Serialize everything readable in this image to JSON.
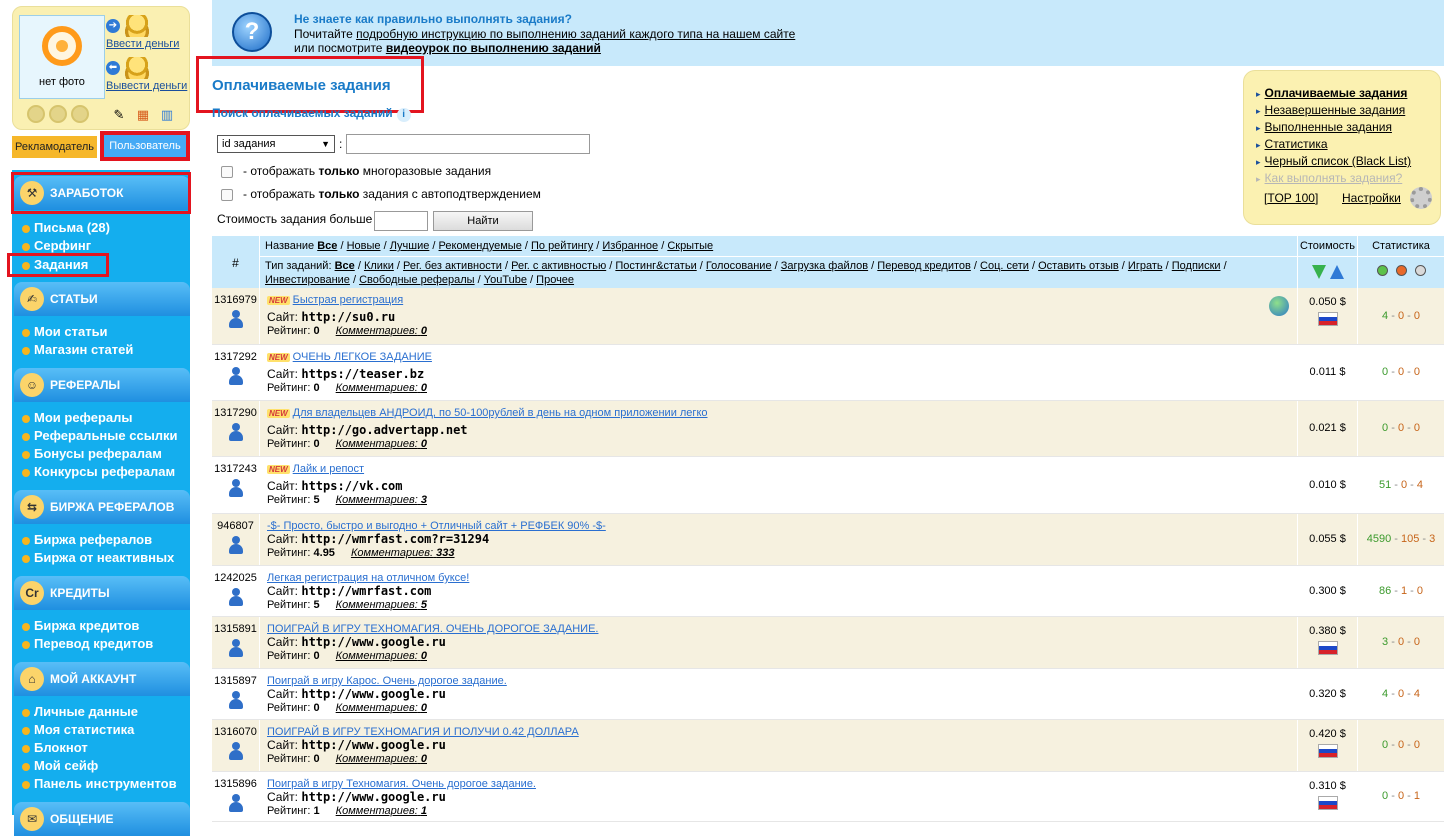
{
  "sidebar": {
    "avatar_caption": "нет фото",
    "deposit_label": "Ввести деньги",
    "withdraw_label": "Вывести деньги",
    "role_advertiser": "Рекламодатель",
    "role_user": "Пользователь",
    "sections": [
      {
        "title": "ЗАРАБОТОК",
        "items": [
          "Письма (28)",
          "Серфинг",
          "Задания"
        ]
      },
      {
        "title": "СТАТЬИ",
        "items": [
          "Мои статьи",
          "Магазин статей"
        ]
      },
      {
        "title": "РЕФЕРАЛЫ",
        "items": [
          "Мои рефералы",
          "Реферальные ссылки",
          "Бонусы рефералам",
          "Конкурсы рефералам"
        ]
      },
      {
        "title": "БИРЖА РЕФЕРАЛОВ",
        "items": [
          "Биржа рефералов",
          "Биржа от неактивных"
        ]
      },
      {
        "title": "КРЕДИТЫ",
        "items": [
          "Биржа кредитов",
          "Перевод кредитов"
        ]
      },
      {
        "title": "МОЙ АККАУНТ",
        "items": [
          "Личные данные",
          "Моя статистика",
          "Блокнот",
          "Мой сейф",
          "Панель инструментов"
        ]
      },
      {
        "title": "ОБЩЕНИЕ",
        "items": []
      }
    ]
  },
  "banner": {
    "question": "Не знаете как правильно выполнять задания?",
    "line2_prefix": "Почитайте ",
    "line2_link": "подробную инструкцию по выполнению заданий каждого типа на нашем сайте",
    "line3_prefix": "или посмотрите ",
    "line3_link": "видеоурок по выполнению заданий"
  },
  "page": {
    "title": "Оплачиваемые задания",
    "search_caption": "Поиск оплачиваемых заданий",
    "select_value": "id задания",
    "chk_multi_pre": "- отображать ",
    "chk_multi_bold": "только",
    "chk_multi_post": " многоразовые задания",
    "chk_auto_pre": "- отображать ",
    "chk_auto_bold": "только",
    "chk_auto_post": " задания с автоподтверждением",
    "cost_label": "Стоимость задания больше",
    "find_button": "Найти"
  },
  "rightbox": {
    "items": [
      "Оплачиваемые задания",
      "Незавершенные задания",
      "Выполненные задания",
      "Статистика",
      "Черный список (Black List)",
      "Как выполнять задания?"
    ],
    "top100": "TOP 100",
    "settings": "Настройки"
  },
  "table": {
    "col_num": "#",
    "col_cost": "Стоимость",
    "col_stat": "Статистика",
    "name_label": "Название",
    "name_filters": [
      "Все",
      "Новые",
      "Лучшие",
      "Рекомендуемые",
      "По рейтингу",
      "Избранное",
      "Скрытые"
    ],
    "type_label": "Тип заданий:",
    "type_filters_l1": [
      "Все",
      "Клики",
      "Рег. без активности",
      "Рег. с активностью",
      "Постинг&статьи",
      "Голосование",
      "Загрузка файлов",
      "Перевод кредитов",
      "Соц. сети",
      "Оставить отзыв",
      "Играть",
      "Подписки"
    ],
    "type_filters_l2": [
      "Инвестирование",
      "Свободные рефералы",
      "YouTube",
      "Прочее"
    ],
    "site_label": "Сайт:",
    "rating_label": "Рейтинг:",
    "comments_label": "Комментариев:",
    "new_badge": "NEW",
    "rows": [
      {
        "id": "1316979",
        "new": true,
        "title": "Быстрая регистрация",
        "site": "http://su0.ru",
        "rating": "0",
        "comments": "0",
        "cost": "0.050 $",
        "flag": true,
        "globe": true,
        "s1": "4",
        "s2": "0",
        "s3": "0"
      },
      {
        "id": "1317292",
        "new": true,
        "title": "ОЧЕНЬ ЛЕГКОЕ ЗАДАНИЕ",
        "site": "https://teaser.bz",
        "rating": "0",
        "comments": "0",
        "cost": "0.011 $",
        "flag": false,
        "s1": "0",
        "s2": "0",
        "s3": "0"
      },
      {
        "id": "1317290",
        "new": true,
        "title": "Для владельцев АНДРОИД, по 50-100рублей в день на одном приложении легко",
        "site": "http://go.advertapp.net",
        "rating": "0",
        "comments": "0",
        "cost": "0.021 $",
        "flag": false,
        "s1": "0",
        "s2": "0",
        "s3": "0"
      },
      {
        "id": "1317243",
        "new": true,
        "title": "Лайк и репост",
        "site": "https://vk.com",
        "rating": "5",
        "comments": "3",
        "cost": "0.010 $",
        "flag": false,
        "s1": "51",
        "s2": "0",
        "s3": "4"
      },
      {
        "id": "946807",
        "new": false,
        "title": "-$-              Просто, быстро и выгодно + Отличный сайт + РЕФБЕК 90%              -$-",
        "site": "http://wmrfast.com?r=31294",
        "rating": "4.95",
        "comments": "333",
        "cost": "0.055 $",
        "flag": false,
        "s1": "4590",
        "s2": "105",
        "s3": "3"
      },
      {
        "id": "1242025",
        "new": false,
        "title": "Легкая регистрация на отличном буксе!",
        "site": "http://wmrfast.com",
        "rating": "5",
        "comments": "5",
        "cost": "0.300 $",
        "flag": false,
        "s1": "86",
        "s2": "1",
        "s3": "0"
      },
      {
        "id": "1315891",
        "new": false,
        "title": "ПОИГРАЙ В ИГРУ ТЕХНОМАГИЯ. ОЧЕНЬ ДОРОГОЕ ЗАДАНИЕ.",
        "site": "http://www.google.ru",
        "rating": "0",
        "comments": "0",
        "cost": "0.380 $",
        "flag": true,
        "s1": "3",
        "s2": "0",
        "s3": "0"
      },
      {
        "id": "1315897",
        "new": false,
        "title": "Поиграй в игру Карос. Очень дорогое задание.",
        "site": "http://www.google.ru",
        "rating": "0",
        "comments": "0",
        "cost": "0.320 $",
        "flag": false,
        "s1": "4",
        "s2": "0",
        "s3": "4"
      },
      {
        "id": "1316070",
        "new": false,
        "title": "ПОИГРАЙ В ИГРУ ТЕХНОМАГИЯ И ПОЛУЧИ 0.42 ДОЛЛАРА",
        "site": "http://www.google.ru",
        "rating": "0",
        "comments": "0",
        "cost": "0.420 $",
        "flag": true,
        "s1": "0",
        "s2": "0",
        "s3": "0"
      },
      {
        "id": "1315896",
        "new": false,
        "title": "Поиграй в игру Техномагия. Очень дорогое задание.",
        "site": "http://www.google.ru",
        "rating": "1",
        "comments": "1",
        "cost": "0.310 $",
        "flag": true,
        "s1": "0",
        "s2": "0",
        "s3": "1"
      }
    ]
  },
  "colors": {
    "menu_bg": "#14aeee",
    "highlight": "#e3141f",
    "banner_bg": "#c8e9fb",
    "yellow_box": "#fbf1b1"
  }
}
